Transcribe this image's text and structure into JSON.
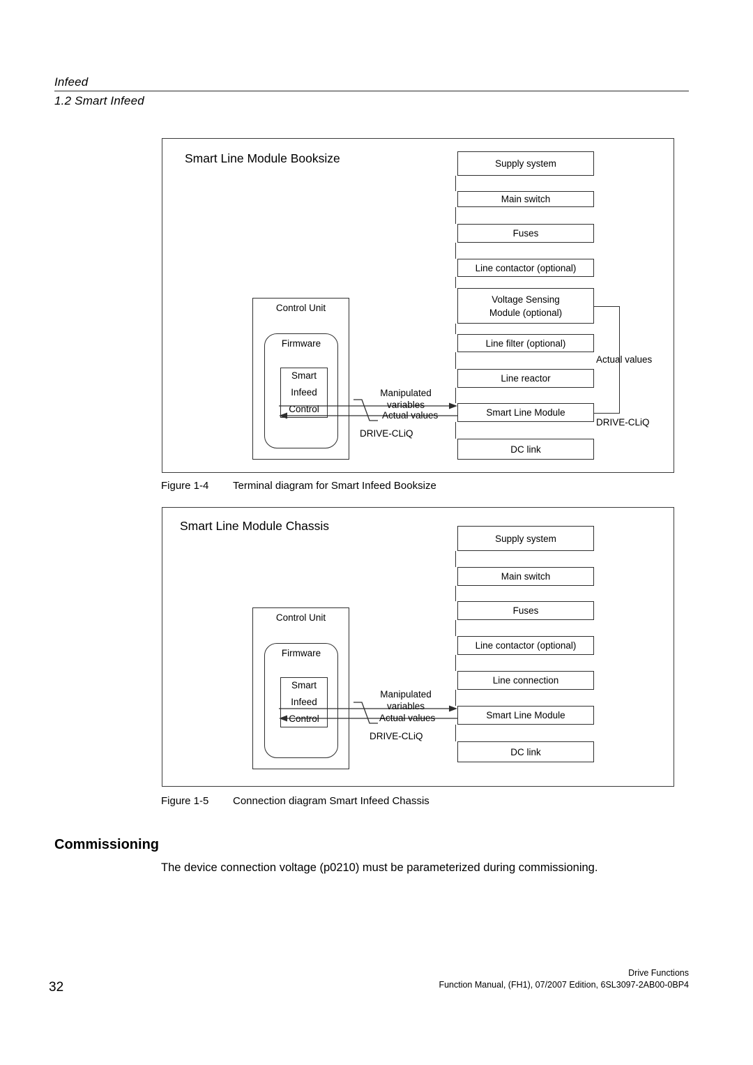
{
  "header": {
    "chapter": "Infeed",
    "section": "1.2 Smart Infeed"
  },
  "figure_1_4": {
    "title": "Smart Line Module Booksize",
    "chain": [
      "Supply system",
      "Main switch",
      "Fuses",
      "Line contactor (optional)",
      "Voltage Sensing",
      "Module (optional)",
      "Line filter (optional)",
      "Line reactor",
      "Smart Line Module",
      "DC link"
    ],
    "control_unit": {
      "outer_label": "Control Unit",
      "firmware_label": "Firmware",
      "inner_line1": "Smart",
      "inner_line2": "Infeed",
      "inner_line3": "Control"
    },
    "edge_labels": {
      "manipulated_line1": "Manipulated",
      "manipulated_line2": "variables",
      "actual_values": "Actual values",
      "driveclid_left": "DRIVE-CLiQ",
      "actual_values_right": "Actual values",
      "driveclid_right": "DRIVE-CLiQ"
    },
    "caption_number": "Figure 1-4",
    "caption_text": "Terminal diagram for Smart Infeed Booksize"
  },
  "figure_1_5": {
    "title": "Smart Line Module Chassis",
    "chain": [
      "Supply system",
      "Main switch",
      "Fuses",
      "Line contactor (optional)",
      "Line connection",
      "Smart Line Module",
      "DC link"
    ],
    "control_unit": {
      "outer_label": "Control Unit",
      "firmware_label": "Firmware",
      "inner_line1": "Smart",
      "inner_line2": "Infeed",
      "inner_line3": "Control"
    },
    "edge_labels": {
      "manipulated_line1": "Manipulated",
      "manipulated_line2": "variables",
      "actual_values": "Actual values",
      "driveclid_left": "DRIVE-CLiQ"
    },
    "caption_number": "Figure 1-5",
    "caption_text": "Connection diagram Smart Infeed Chassis"
  },
  "body": {
    "commissioning_heading": "Commissioning",
    "commissioning_paragraph": "The device connection voltage (p0210) must be parameterized during commissioning."
  },
  "footer": {
    "page_number": "32",
    "doc_title": "Drive Functions",
    "doc_reference": "Function Manual, (FH1), 07/2007 Edition, 6SL3097-2AB00-0BP4"
  }
}
